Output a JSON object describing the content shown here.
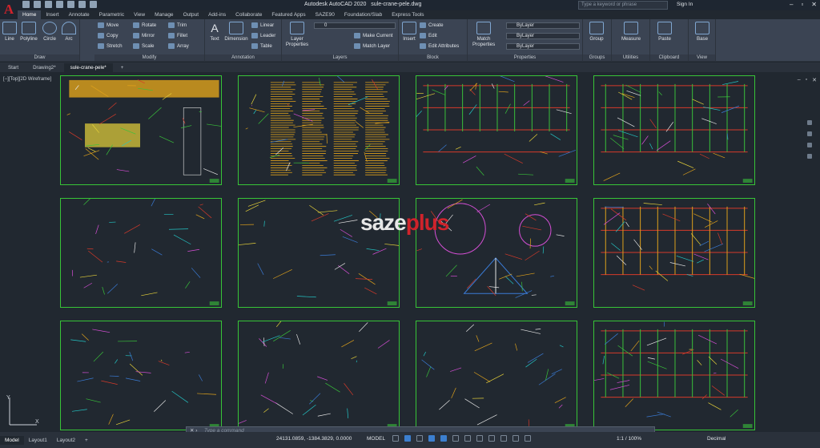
{
  "app": {
    "title": "Autodesk AutoCAD 2020",
    "file": "sule-crane-pele.dwg",
    "search_placeholder": "Type a keyword or phrase",
    "sign_in": "Sign In"
  },
  "ribbon_tabs": [
    "Home",
    "Insert",
    "Annotate",
    "Parametric",
    "View",
    "Manage",
    "Output",
    "Add-ins",
    "Collaborate",
    "Featured Apps",
    "SAZE90",
    "Foundation/Slab",
    "Express Tools"
  ],
  "draw": {
    "panel": "Draw",
    "line": "Line",
    "polyline": "Polyline",
    "circle": "Circle",
    "arc": "Arc"
  },
  "modify": {
    "panel": "Modify",
    "move": "Move",
    "rotate": "Rotate",
    "trim": "Trim",
    "copy": "Copy",
    "mirror": "Mirror",
    "fillet": "Fillet",
    "stretch": "Stretch",
    "scale": "Scale",
    "array": "Array"
  },
  "annotation": {
    "panel": "Annotation",
    "text": "Text",
    "dimension": "Dimension",
    "linear": "Linear",
    "leader": "Leader",
    "table": "Table"
  },
  "layers": {
    "panel": "Layers",
    "layer_properties": "Layer Properties",
    "current_layer": "0",
    "make_current": "Make Current",
    "match_layer": "Match Layer"
  },
  "block": {
    "panel": "Block",
    "insert": "Insert",
    "create": "Create",
    "edit": "Edit",
    "edit_attributes": "Edit Attributes"
  },
  "properties": {
    "panel": "Properties",
    "match": "Match Properties",
    "color": "ByLayer",
    "linetype": "ByLayer",
    "lineweight": "ByLayer"
  },
  "groups": {
    "panel": "Groups",
    "group": "Group"
  },
  "utilities": {
    "panel": "Utilities",
    "measure": "Measure"
  },
  "clipboard": {
    "panel": "Clipboard",
    "paste": "Paste"
  },
  "view": {
    "panel": "View",
    "base": "Base"
  },
  "doc_tabs": [
    "Start",
    "Drawing2*",
    "sule-crane-pele*"
  ],
  "viewport_label": "[−][Top][2D Wireframe]",
  "watermark": {
    "a": "saze",
    "b": "plus"
  },
  "command": {
    "placeholder": "Type a command"
  },
  "layout_tabs": [
    "Model",
    "Layout1",
    "Layout2"
  ],
  "status": {
    "coords": "24131.0859, -1384.3829, 0.0000",
    "model": "MODEL",
    "scale": "1:1 / 100%",
    "units": "Decimal"
  },
  "colors": {
    "sheet_border": "#37c437",
    "accent_red": "#d0232b",
    "bg": "#212830"
  }
}
